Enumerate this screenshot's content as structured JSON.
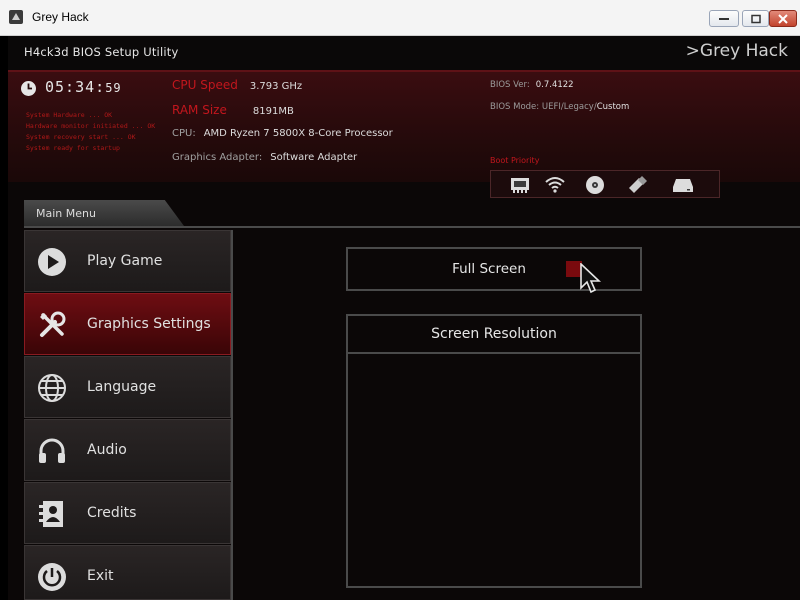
{
  "window": {
    "title": "Grey Hack"
  },
  "header": {
    "title": "H4ck3d BIOS Setup Utility",
    "brand": "Grey Hack",
    "brand_prefix": ">"
  },
  "clock": {
    "hm": "05:34:",
    "sec": "59"
  },
  "system_lines": [
    "System Hardware ... OK",
    "Hardware monitor initiated ... OK",
    "System recovery start ... OK",
    "System ready for startup"
  ],
  "specs": {
    "cpu_speed_label": "CPU Speed",
    "cpu_speed": "3.793 GHz",
    "ram_label": "RAM Size",
    "ram": "8191MB",
    "cpu_label": "CPU:",
    "cpu": "AMD Ryzen 7 5800X 8-Core Processor",
    "gpu_label": "Graphics Adapter:",
    "gpu": "Software Adapter"
  },
  "bios": {
    "ver_label": "BIOS Ver:",
    "ver": "0.7.4122",
    "mode_label": "BIOS Mode: UEFI/Legacy/",
    "mode": "Custom",
    "boot_label": "Boot Priority"
  },
  "boot_devices": [
    "network-card-icon",
    "wifi-icon",
    "optical-disc-icon",
    "usb-drive-icon",
    "hard-drive-icon"
  ],
  "menu": {
    "title": "Main Menu",
    "items": [
      {
        "label": "Play Game",
        "icon": "play-icon"
      },
      {
        "label": "Graphics Settings",
        "icon": "tools-icon"
      },
      {
        "label": "Language",
        "icon": "globe-icon"
      },
      {
        "label": "Audio",
        "icon": "headphones-icon"
      },
      {
        "label": "Credits",
        "icon": "contacts-icon"
      },
      {
        "label": "Exit",
        "icon": "power-icon"
      }
    ],
    "active_index": 1
  },
  "graphics": {
    "fullscreen_label": "Full Screen",
    "fullscreen_checked": true,
    "resolution_label": "Screen Resolution",
    "resolutions": []
  },
  "colors": {
    "accent": "#c2161d",
    "active_bg": "#6e0d12"
  }
}
